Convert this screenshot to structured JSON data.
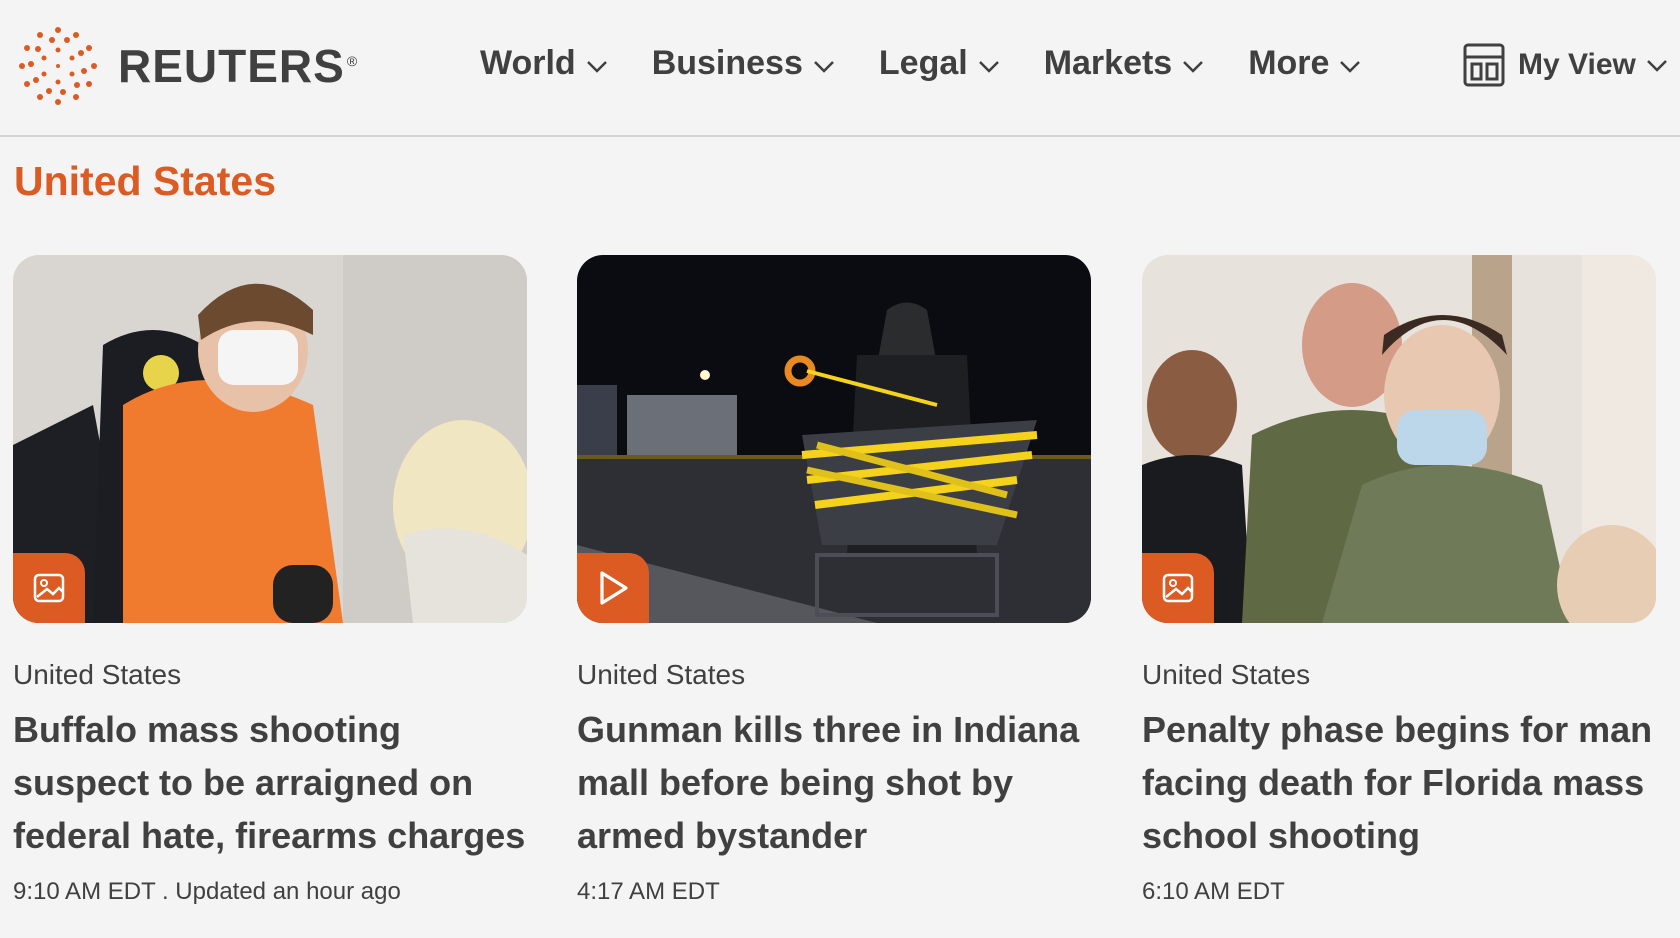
{
  "brand": {
    "name": "REUTERS",
    "reg": "®",
    "accent": "#dc5b23"
  },
  "nav": {
    "items": [
      {
        "label": "World"
      },
      {
        "label": "Business"
      },
      {
        "label": "Legal"
      },
      {
        "label": "Markets"
      },
      {
        "label": "More"
      }
    ],
    "my_view": "My View"
  },
  "section": {
    "title": "United States"
  },
  "cards": [
    {
      "kicker": "United States",
      "title": "Buffalo mass shooting suspect to be arraigned on federal hate, firearms charges",
      "time": "9:10 AM EDT . Updated an hour ago",
      "media": "image-icon"
    },
    {
      "kicker": "United States",
      "title": "Gunman kills three in Indiana mall before being shot by armed bystander",
      "time": "4:17 AM EDT",
      "media": "play-icon"
    },
    {
      "kicker": "United States",
      "title": "Penalty phase begins for man facing death for Florida mass school shooting",
      "time": "6:10 AM EDT",
      "media": "image-icon"
    }
  ]
}
